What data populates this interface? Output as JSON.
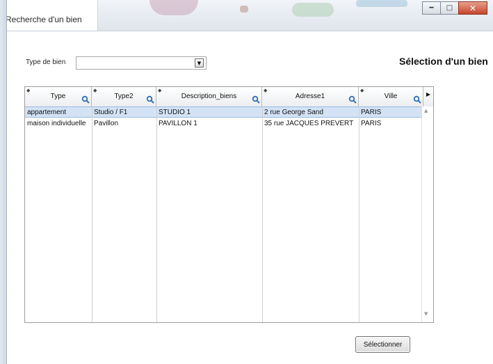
{
  "window": {
    "title": "Recherche d'un bien",
    "controls": [
      "minimize-icon",
      "maximize-icon",
      "close-icon"
    ]
  },
  "form": {
    "type_label": "Type de bien",
    "type_value": "",
    "heading": "Sélection d'un bien"
  },
  "grid": {
    "columns": [
      "Type",
      "Type2",
      "Description_biens",
      "Adresse1",
      "Ville"
    ],
    "rows": [
      [
        "appartement",
        "Studio / F1",
        "STUDIO 1",
        "2 rue George Sand",
        "PARIS"
      ],
      [
        "maison individuelle",
        "Pavillon",
        "PAVILLON 1",
        "35 rue JACQUES PREVERT",
        "PARIS"
      ]
    ],
    "selected_row": 0
  },
  "actions": {
    "select_label": "Sélectionner"
  },
  "colors": {
    "selection": "#d3e3f5",
    "close_button": "#c7452b"
  }
}
